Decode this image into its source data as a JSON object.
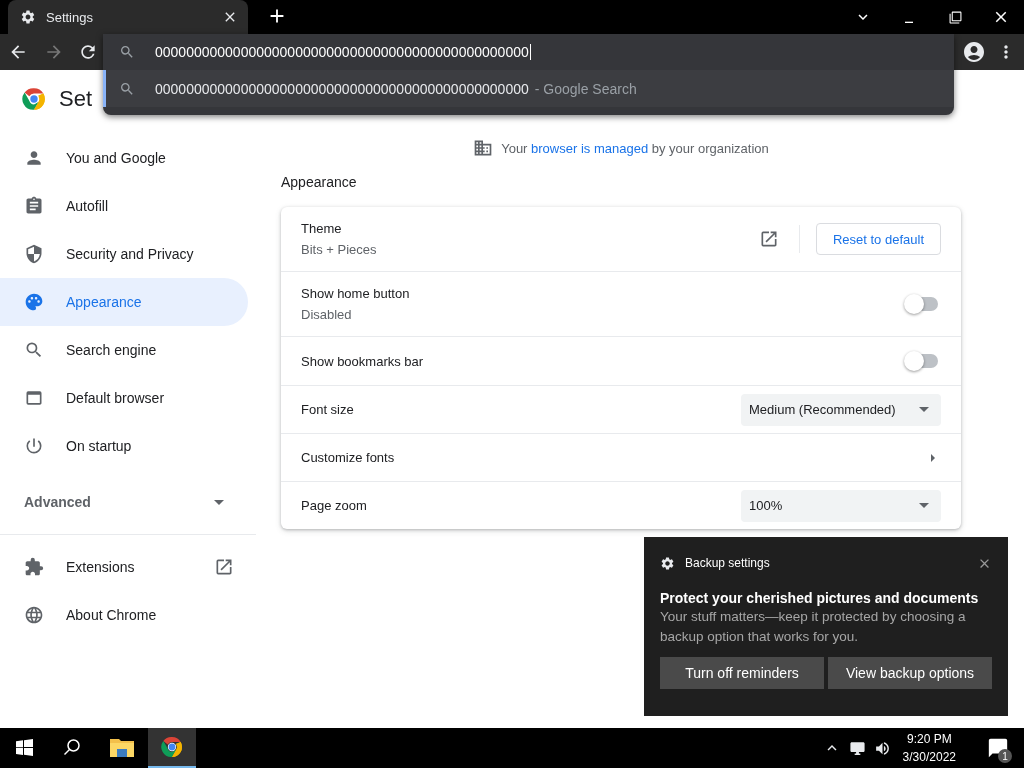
{
  "window": {
    "tab_title": "Settings"
  },
  "toolbar": {
    "back_disabled": false,
    "forward_disabled": true
  },
  "omnibox": {
    "value": "000000000000000000000000000000000000000000000000",
    "suggestion": {
      "text": "000000000000000000000000000000000000000000000000",
      "suffix": "- Google Search",
      "selected": true
    }
  },
  "page_title": "Set",
  "sidebar": {
    "items": [
      {
        "label": "You and Google",
        "selected": false
      },
      {
        "label": "Autofill",
        "selected": false
      },
      {
        "label": "Security and Privacy",
        "selected": false
      },
      {
        "label": "Appearance",
        "selected": true
      },
      {
        "label": "Search engine",
        "selected": false
      },
      {
        "label": "Default browser",
        "selected": false
      },
      {
        "label": "On startup",
        "selected": false
      }
    ],
    "advanced": {
      "label": "Advanced",
      "expanded": false
    },
    "more_items": [
      {
        "label": "Extensions",
        "selected": false,
        "opens_new_tab": true
      },
      {
        "label": "About Chrome",
        "selected": false,
        "opens_new_tab": false
      }
    ]
  },
  "managed_notice": {
    "before": "Your ",
    "link": "browser is managed",
    "after": " by your organization"
  },
  "section": {
    "title": "Appearance",
    "rows": [
      {
        "kind": "theme",
        "label": "Theme",
        "sublabel": "Bits + Pieces",
        "button": "Reset to default"
      },
      {
        "kind": "toggle",
        "label": "Show home button",
        "sublabel": "Disabled",
        "on": false
      },
      {
        "kind": "toggle",
        "label": "Show bookmarks bar",
        "on": false
      },
      {
        "kind": "select",
        "label": "Font size",
        "value": "Medium (Recommended)"
      },
      {
        "kind": "link",
        "label": "Customize fonts"
      },
      {
        "kind": "select",
        "label": "Page zoom",
        "value": "100%"
      }
    ]
  },
  "toast": {
    "app": "Backup settings",
    "title": "Protect your cherished pictures and documents",
    "body": "Your stuff matters—keep it protected by choosing a backup option that works for you.",
    "buttons": [
      "Turn off reminders",
      "View backup options"
    ]
  },
  "taskbar": {
    "apps": [
      {
        "selected": false
      },
      {
        "selected": true
      }
    ],
    "time": "9:20 PM",
    "date": "3/30/2022",
    "notifications": "1"
  }
}
